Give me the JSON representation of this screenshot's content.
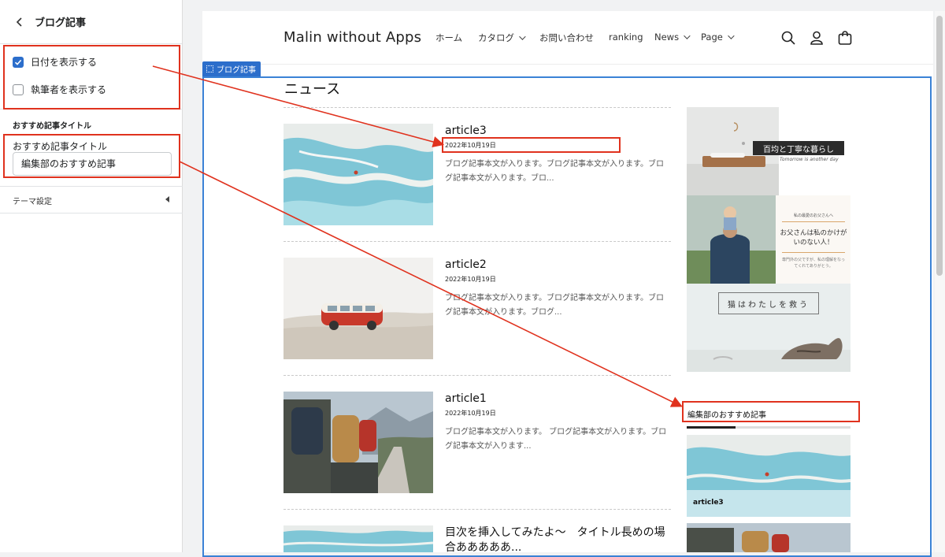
{
  "sidebar": {
    "title": "ブログ記事",
    "show_date_label": "日付を表示する",
    "show_date_checked": true,
    "show_author_label": "執筆者を表示する",
    "show_author_checked": false,
    "reco_section_label": "おすすめ記事タイトル",
    "reco_field_label": "おすすめ記事タイトル",
    "reco_field_value": "編集部のおすすめ記事",
    "theme_settings_label": "テーマ設定"
  },
  "store": {
    "logo": "Malin without Apps",
    "nav": [
      {
        "label": "ホーム",
        "dropdown": false
      },
      {
        "label": "カタログ",
        "dropdown": true
      },
      {
        "label": "お問い合わせ",
        "dropdown": false
      },
      {
        "label": "ranking",
        "dropdown": false
      },
      {
        "label": "News",
        "dropdown": true
      },
      {
        "label": "Page",
        "dropdown": true
      }
    ],
    "icons": [
      "search-icon",
      "account-icon",
      "cart-icon"
    ]
  },
  "section_tag": "ブログ記事",
  "page_heading": "ニュース",
  "articles": [
    {
      "title": "article3",
      "date": "2022年10月19日",
      "body": "ブログ記事本文が入ります。ブログ記事本文が入ります。ブログ記事本文が入ります。ブロ..."
    },
    {
      "title": "article2",
      "date": "2022年10月19日",
      "body": "ブログ記事本文が入ります。ブログ記事本文が入ります。ブログ記事本文が入ります。ブログ..."
    },
    {
      "title": "article1",
      "date": "2022年10月19日",
      "body": "ブログ記事本文が入ります。 ブログ記事本文が入ります。ブログ記事本文が入ります..."
    },
    {
      "title": "目次を挿入してみたよ〜　タイトル長めの場合あああああ..."
    }
  ],
  "side_banners": {
    "banner1_text": "百均と丁寧な暮らし",
    "banner1_sub": "Tomorrow is another day",
    "banner2_top": "私の最愛のお父さんへ",
    "banner2_text": "お父さんは私のかけがいのない人！",
    "banner2_sub": "専門外の父ですが、私の理解をなってくれてありがとう。",
    "banner3_text": "猫はわたしを救う"
  },
  "recommend": {
    "title": "編集部のおすすめ記事",
    "progress_fraction": 0.3,
    "card_label": "article3"
  },
  "colors": {
    "accent": "#2c6ecb",
    "annotation": "#e0321e"
  }
}
